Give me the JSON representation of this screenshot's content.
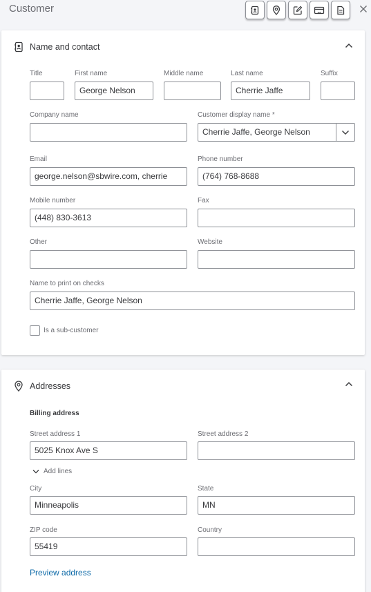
{
  "panel": {
    "title": "Customer"
  },
  "toolbar": {
    "buttons": [
      "contact-card-icon",
      "location-pin-icon",
      "edit-icon",
      "payment-icon",
      "document-icon"
    ],
    "close": "close-icon"
  },
  "name_contact": {
    "title": "Name and contact",
    "labels": {
      "title": "Title",
      "first": "First name",
      "middle": "Middle name",
      "last": "Last name",
      "suffix": "Suffix",
      "company": "Company name",
      "display": "Customer display name *",
      "email": "Email",
      "phone": "Phone number",
      "mobile": "Mobile number",
      "fax": "Fax",
      "other": "Other",
      "website": "Website",
      "print": "Name to print on checks"
    },
    "values": {
      "title": "",
      "first": "George Nelson",
      "middle": "",
      "last": "Cherrie Jaffe",
      "suffix": "",
      "company": "",
      "display": "Cherrie Jaffe, George Nelson",
      "email": "george.nelson@sbwire.com, cherrie",
      "phone": "(764) 768-8688",
      "mobile": "(448) 830-3613",
      "fax": "",
      "other": "",
      "website": "",
      "print": "Cherrie Jaffe, George Nelson"
    },
    "sub_customer": {
      "label": "Is a sub-customer",
      "checked": false
    }
  },
  "addresses": {
    "title": "Addresses",
    "billing_heading": "Billing address",
    "labels": {
      "street1": "Street address 1",
      "street2": "Street address 2",
      "city": "City",
      "state": "State",
      "zip": "ZIP code",
      "country": "Country"
    },
    "values": {
      "street1": "5025 Knox Ave S",
      "street2": "",
      "city": "Minneapolis",
      "state": "MN",
      "zip": "55419",
      "country": ""
    },
    "add_lines": "Add lines",
    "preview_link": "Preview address"
  },
  "colors": {
    "link": "#0d6aa8",
    "border": "#8d9096",
    "text": "#393a3d",
    "label": "#6b6c72",
    "background": "#f4f5f8"
  }
}
